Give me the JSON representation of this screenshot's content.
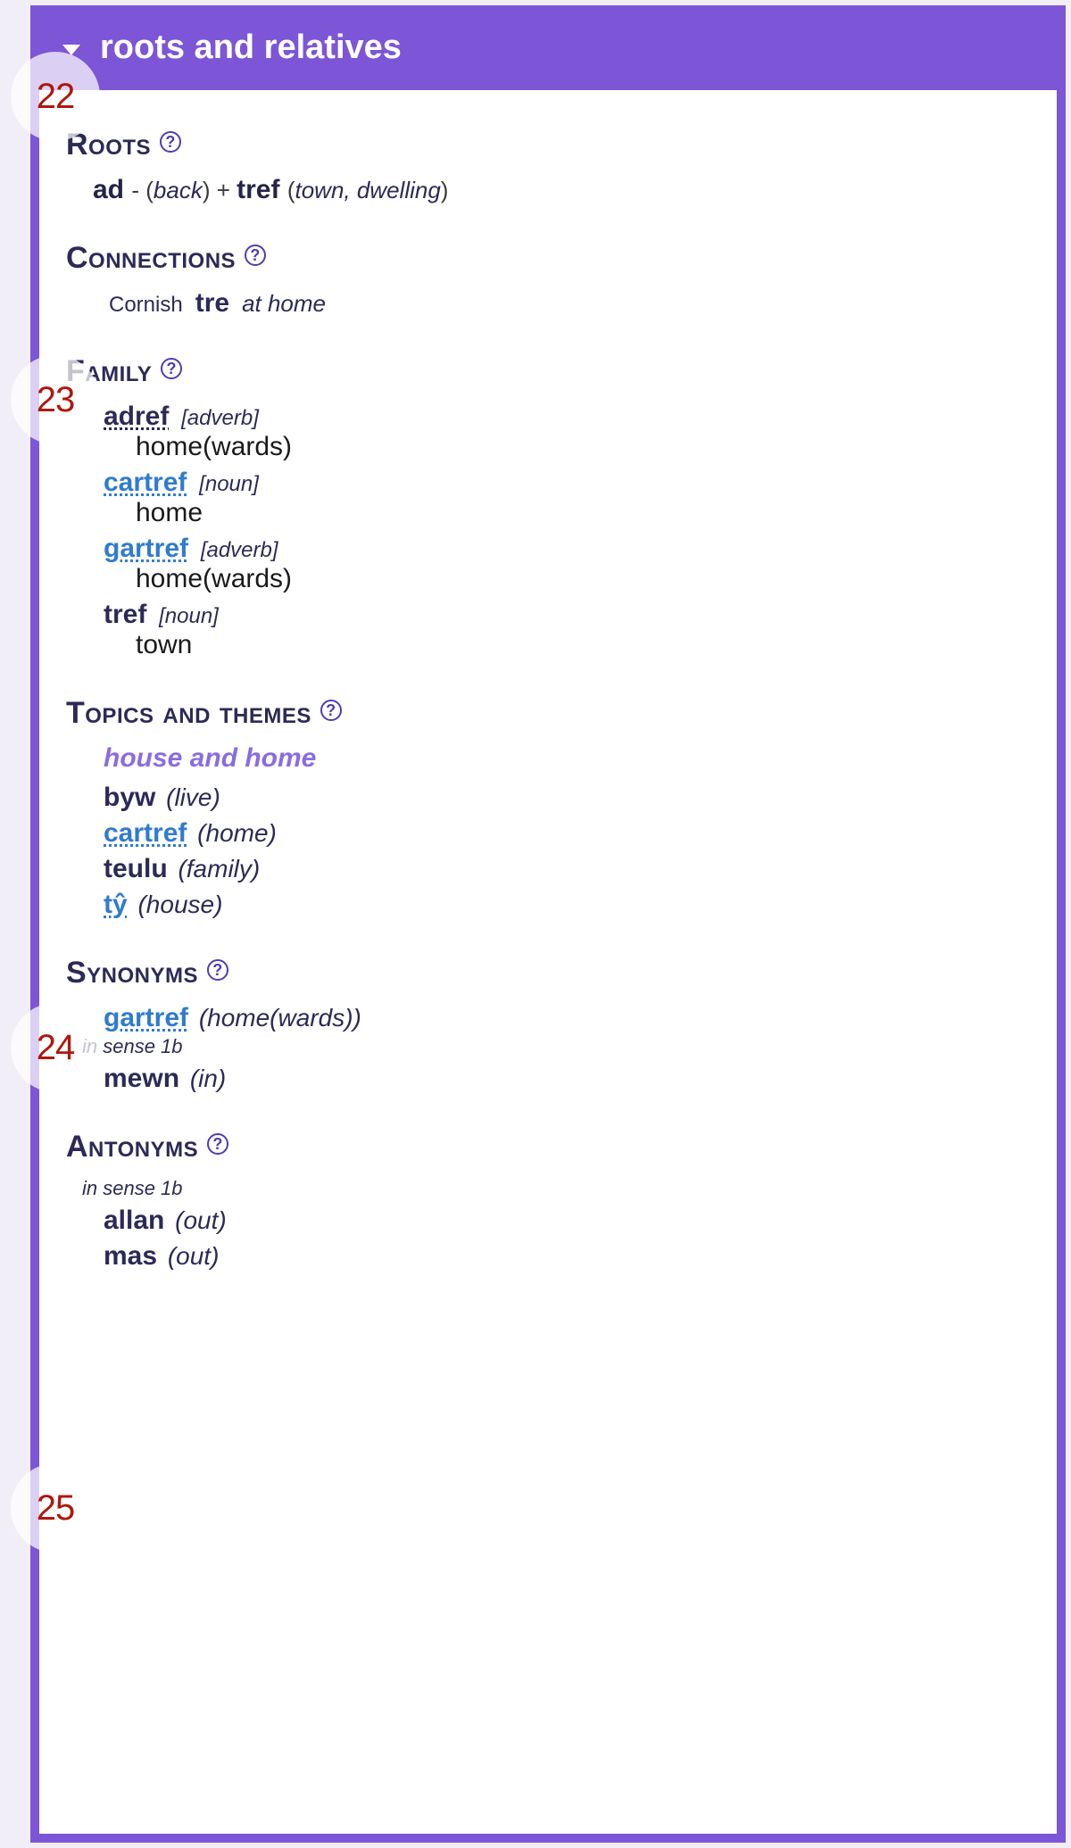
{
  "balloons": {
    "n22": "22",
    "n23": "23",
    "n24": "24",
    "n25": "25"
  },
  "panel": {
    "title": "roots and relatives",
    "sections": {
      "roots": {
        "title": "Roots",
        "line": {
          "part1_word": "ad",
          "part1_hyphen": " - (",
          "part1_gloss": "back",
          "close1": ") + ",
          "part2_word": "tref",
          "open2": " (",
          "part2_gloss": "town, dwelling",
          "close2": ")"
        }
      },
      "connections": {
        "title": "Connections",
        "rows": [
          {
            "lang": "Cornish",
            "word": "tre",
            "gloss": "at home"
          }
        ]
      },
      "family": {
        "title": "Family",
        "entries": [
          {
            "word": "adref",
            "linkStyle": "darklink",
            "pos": "[adverb]",
            "def": "home(wards)"
          },
          {
            "word": "cartref",
            "linkStyle": "link",
            "pos": "[noun]",
            "def": "home"
          },
          {
            "word": "gartref",
            "linkStyle": "link",
            "pos": "[adverb]",
            "def": "home(wards)"
          },
          {
            "word": "tref",
            "linkStyle": "",
            "pos": "[noun]",
            "def": "town"
          }
        ]
      },
      "topics": {
        "title": "Topics and themes",
        "heading": "house and home",
        "entries": [
          {
            "word": "byw",
            "linkStyle": "",
            "gloss": "(live)"
          },
          {
            "word": "cartref",
            "linkStyle": "link",
            "gloss": "(home)"
          },
          {
            "word": "teulu",
            "linkStyle": "",
            "gloss": "(family)"
          },
          {
            "word": "tŷ",
            "linkStyle": "link",
            "gloss": "(house)"
          }
        ]
      },
      "synonyms": {
        "title": "Synonyms",
        "entries_a": [
          {
            "word": "gartref",
            "linkStyle": "link",
            "gloss": "(home(wards))"
          }
        ],
        "sense_note": "in sense 1b",
        "entries_b": [
          {
            "word": "mewn",
            "linkStyle": "",
            "gloss": "(in)"
          }
        ]
      },
      "antonyms": {
        "title": "Antonyms",
        "sense_note": "in sense 1b",
        "entries": [
          {
            "word": "allan",
            "linkStyle": "",
            "gloss": "(out)"
          },
          {
            "word": "mas",
            "linkStyle": "",
            "gloss": "(out)"
          }
        ]
      }
    }
  }
}
